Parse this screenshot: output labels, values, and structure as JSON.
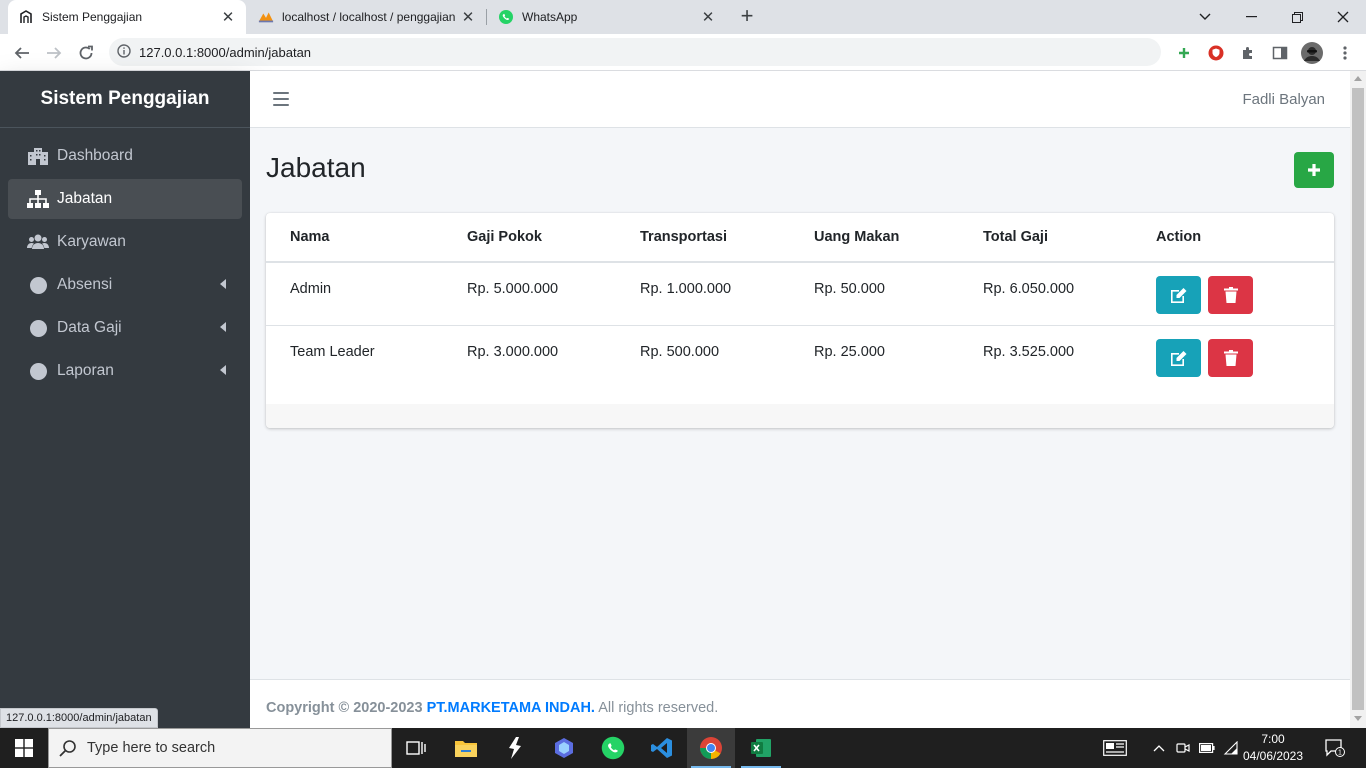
{
  "browser": {
    "tabs": [
      {
        "title": "Sistem Penggajian",
        "close": "✕"
      },
      {
        "title": "localhost / localhost / penggajian",
        "close": "✕"
      },
      {
        "title": "WhatsApp",
        "close": "✕"
      }
    ],
    "url": "127.0.0.1:8000/admin/jabatan",
    "status_url": "127.0.0.1:8000/admin/jabatan"
  },
  "app": {
    "brand": "Sistem Penggajian",
    "user": "Fadli Balyan",
    "sidebar": [
      {
        "label": "Dashboard",
        "icon": "building-icon"
      },
      {
        "label": "Jabatan",
        "icon": "sitemap-icon",
        "active": true
      },
      {
        "label": "Karyawan",
        "icon": "users-icon"
      },
      {
        "label": "Absensi",
        "icon": "circle-icon"
      },
      {
        "label": "Data Gaji",
        "icon": "circle-icon"
      },
      {
        "label": "Laporan",
        "icon": "circle-icon"
      }
    ],
    "page_title": "Jabatan",
    "table": {
      "headers": [
        "Nama",
        "Gaji Pokok",
        "Transportasi",
        "Uang Makan",
        "Total Gaji",
        "Action"
      ],
      "rows": [
        [
          "Admin",
          "Rp. 5.000.000",
          "Rp. 1.000.000",
          "Rp. 50.000",
          "Rp. 6.050.000"
        ],
        [
          "Team Leader",
          "Rp. 3.000.000",
          "Rp. 500.000",
          "Rp. 25.000",
          "Rp. 3.525.000"
        ]
      ]
    },
    "footer": {
      "prefix": "Copyright © 2020-2023",
      "company": "PT.MARKETAMA INDAH.",
      "suffix": "All rights reserved."
    }
  },
  "taskbar": {
    "search_placeholder": "Type here to search",
    "time": "7:00",
    "date": "04/06/2023"
  },
  "colors": {
    "sidebar": "#343a40",
    "add_button": "#28a745",
    "edit_button": "#17a2b8",
    "delete_button": "#dc3545",
    "footer_link": "#007bff"
  }
}
